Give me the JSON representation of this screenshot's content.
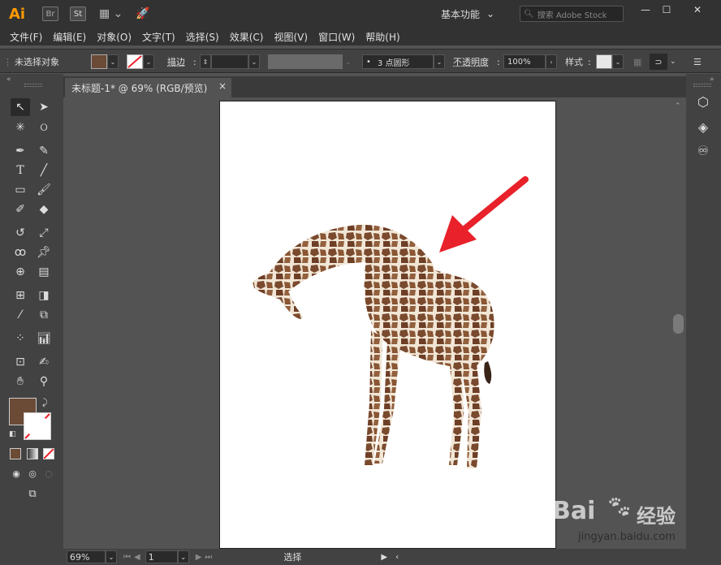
{
  "titlebar": {
    "logo": "Ai",
    "bridge_chip": "Br",
    "stock_chip": "St",
    "workspace": "基本功能",
    "search_placeholder": "搜索 Adobe Stock"
  },
  "menu": [
    "文件(F)",
    "编辑(E)",
    "对象(O)",
    "文字(T)",
    "选择(S)",
    "效果(C)",
    "视图(V)",
    "窗口(W)",
    "帮助(H)"
  ],
  "control": {
    "selection_status": "未选择对象",
    "stroke_label": "描边",
    "brush_value": "3 点圆形",
    "opacity_label": "不透明度",
    "opacity_value": "100%",
    "style_label": "样式",
    "fill_color": "#6b4a36",
    "stroke_color": "none"
  },
  "document": {
    "tab_title": "未标题-1* @ 69% (RGB/预览)",
    "close_glyph": "×"
  },
  "statusbar": {
    "zoom": "69%",
    "artboard_number": "1",
    "tool_status": "选择"
  },
  "watermark": {
    "brand": "Bai",
    "brand2": "经验",
    "url": "jingyan.baidu.com"
  },
  "colors": {
    "accent_orange": "#ff9a00",
    "arrow_red": "#e8212a",
    "fill_brown": "#6b4a36"
  }
}
